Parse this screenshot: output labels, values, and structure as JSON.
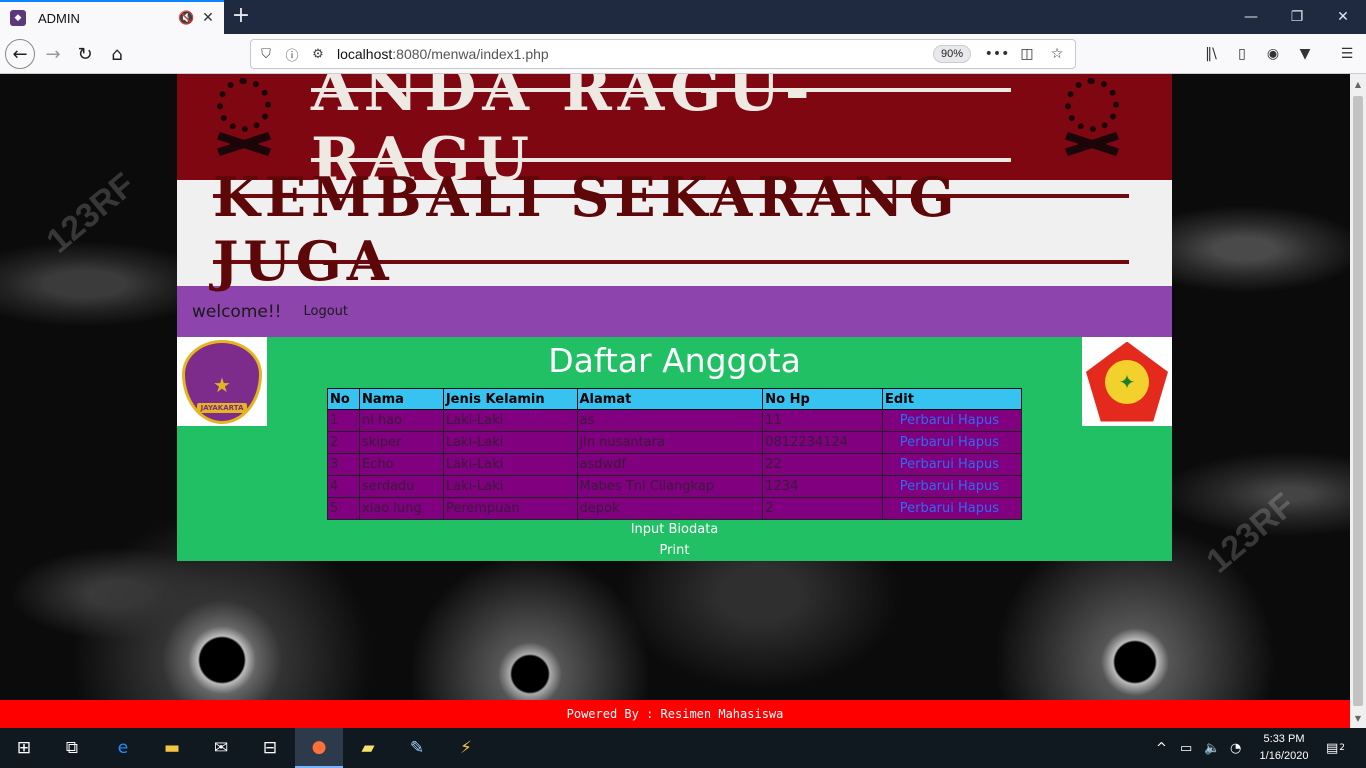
{
  "browser": {
    "tab_title": "ADMIN",
    "new_tab": "+",
    "url_host": "localhost",
    "url_path": ":8080/menwa/index1.php",
    "zoom": "90%",
    "window_controls": [
      "—",
      "❐",
      "✕"
    ]
  },
  "page": {
    "banner_top": "ANDA RAGU-RAGU",
    "banner_bottom": "KEMBALI SEKARANG JUGA",
    "nav": {
      "welcome": "welcome!!",
      "logout": "Logout"
    },
    "heading": "Daftar Anggota",
    "logo_left_text": "JAYAKARTA",
    "table": {
      "headers": [
        "No",
        "Nama",
        "Jenis Kelamin",
        "Alamat",
        "No Hp",
        "Edit"
      ],
      "rows": [
        {
          "no": "1",
          "nama": "ni hao",
          "jk": "Laki-Laki",
          "alamat": "as",
          "hp": "11",
          "edit": "Perbarui Hapus"
        },
        {
          "no": "2",
          "nama": "skiper",
          "jk": "Laki-Laki",
          "alamat": "jln nusantara",
          "hp": "0812234124",
          "edit": "Perbarui Hapus"
        },
        {
          "no": "3",
          "nama": "Echo",
          "jk": "Laki-Laki",
          "alamat": "asdwdf",
          "hp": "22",
          "edit": "Perbarui Hapus"
        },
        {
          "no": "4",
          "nama": "serdadu",
          "jk": "Laki-Laki",
          "alamat": "Mabes Tni Cilangkap",
          "hp": "1234",
          "edit": "Perbarui Hapus"
        },
        {
          "no": "5",
          "nama": "xiao lung",
          "jk": "Perempuan",
          "alamat": "depok",
          "hp": "2",
          "edit": "Perbarui Hapus"
        }
      ]
    },
    "links": {
      "input": "Input Biodata",
      "print": "Print"
    },
    "footer": "Powered By : Resimen Mahasiswa",
    "watermark": "123RF"
  },
  "taskbar": {
    "time": "5:33 PM",
    "date": "1/16/2020",
    "notifications": "2"
  },
  "colors": {
    "banner_red": "#7e0712",
    "nav_purple": "#8e44ad",
    "content_green": "#22c065",
    "table_header": "#36c3f1",
    "table_row": "#800080",
    "footer_red": "#ff0000"
  }
}
